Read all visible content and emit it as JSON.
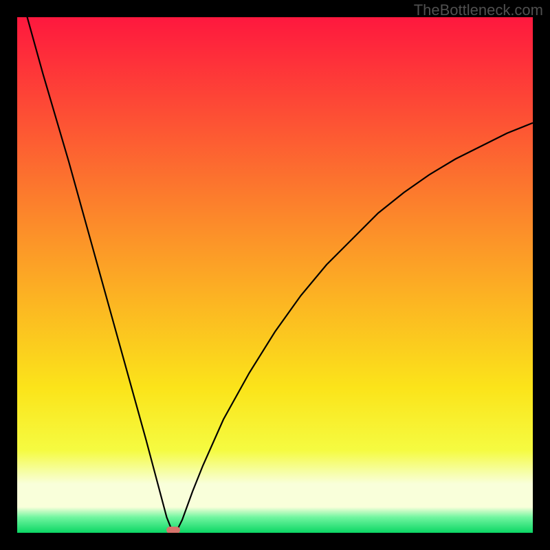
{
  "watermark": "TheBottleneck.com",
  "colors": {
    "top": "#fe183e",
    "mid1": "#fc8b2a",
    "mid2": "#fbe41a",
    "mid3": "#f5fb41",
    "mid35": "#f6fea1",
    "band": "#f9ffda",
    "low1": "#70f59f",
    "bottom": "#0bd664",
    "curve": "#000000",
    "marker": "#d6736b",
    "background": "#000000"
  },
  "chart_data": {
    "type": "line",
    "title": "",
    "xlabel": "",
    "ylabel": "",
    "xlim": [
      0,
      100
    ],
    "ylim": [
      0,
      100
    ],
    "grid": false,
    "legend": false,
    "annotations": [
      "TheBottleneck.com"
    ],
    "series": [
      {
        "name": "bottleneck-curve",
        "x": [
          0,
          5,
          10,
          15,
          20,
          25,
          29,
          30,
          31,
          32,
          34,
          36,
          40,
          45,
          50,
          55,
          60,
          65,
          70,
          75,
          80,
          85,
          90,
          95,
          100
        ],
        "y": [
          107,
          89,
          72,
          54,
          36,
          18,
          3,
          0.5,
          0.5,
          2.5,
          8,
          13,
          22,
          31,
          39,
          46,
          52,
          57,
          62,
          66,
          69.5,
          72.5,
          75,
          77.5,
          79.5
        ]
      }
    ],
    "marker": {
      "x": 30.2,
      "y": 0.5
    },
    "notes": "V-shaped bottleneck curve over a vertical red→yellow→green gradient. Minimum (optimal point) around x≈30. Axes have no visible tick labels; values inferred as 0–100 percentage scale."
  }
}
